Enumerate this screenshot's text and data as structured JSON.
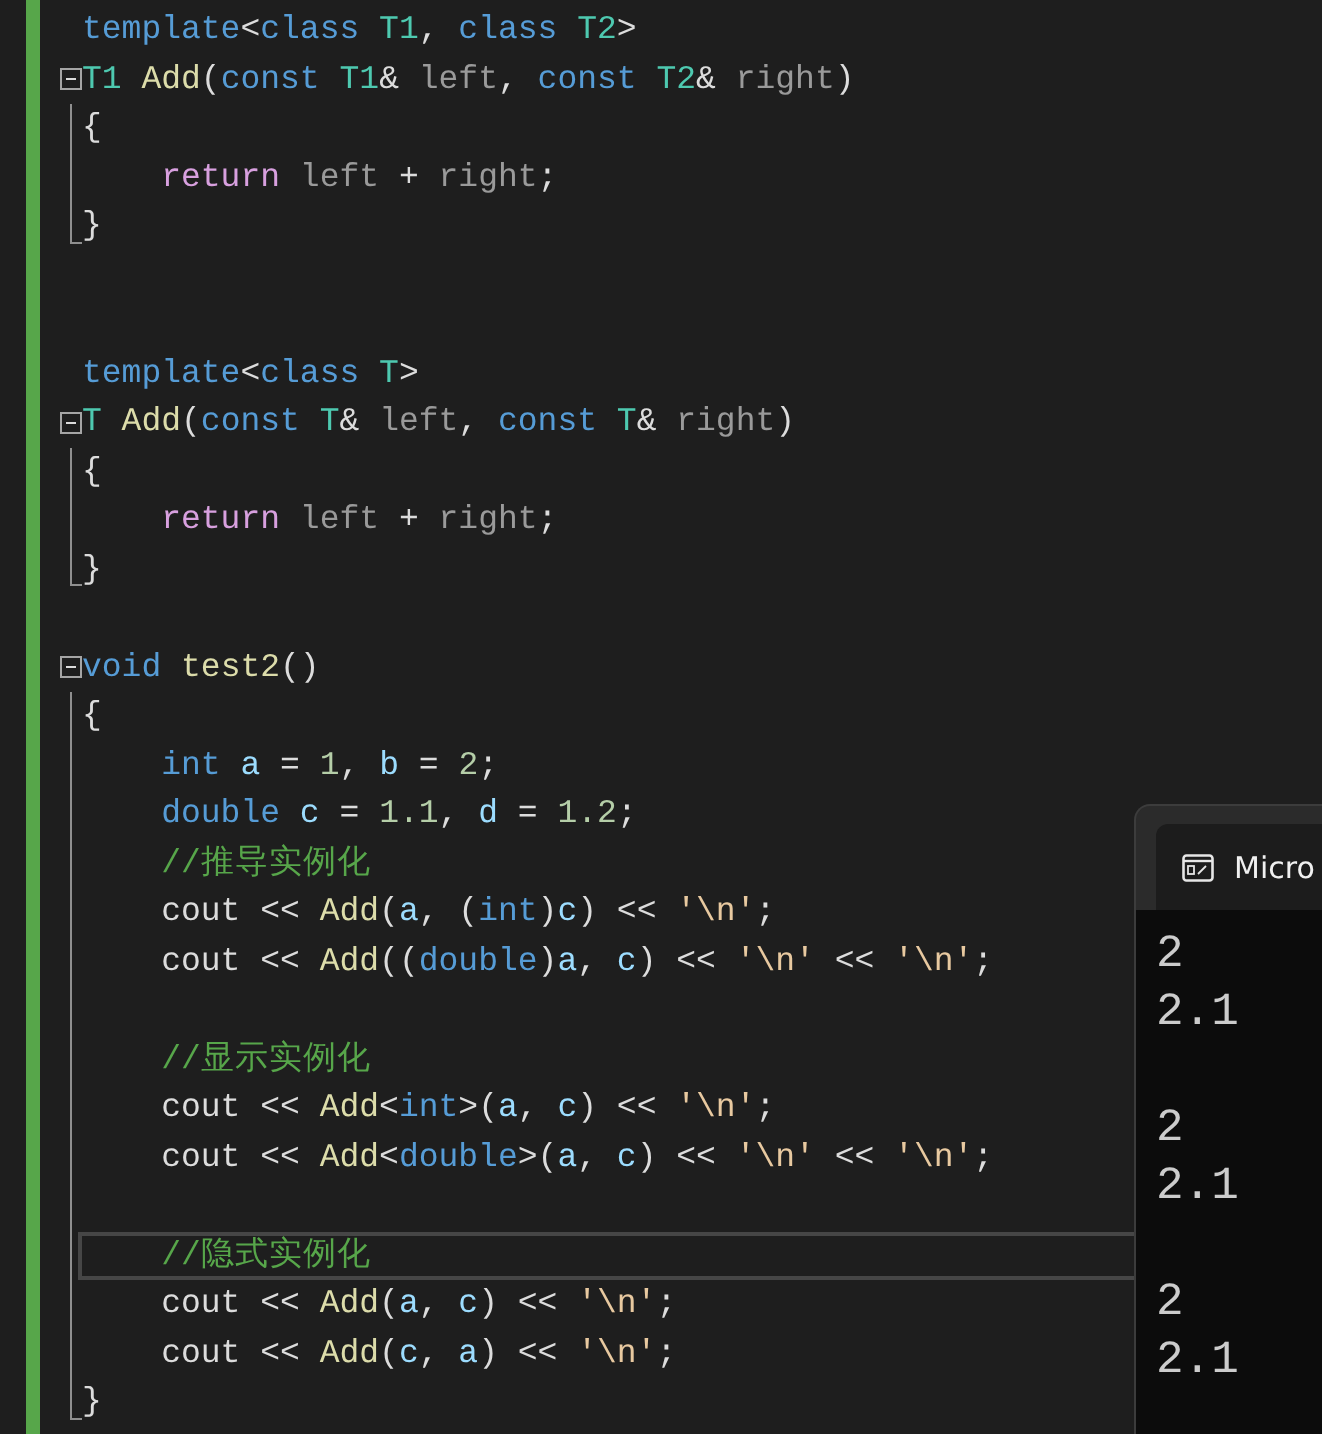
{
  "editor": {
    "lines": [
      {
        "kind": "code",
        "tokens": [
          {
            "kind": "kw",
            "text": "template"
          },
          {
            "kind": "op",
            "text": "<"
          },
          {
            "kind": "kw",
            "text": "class"
          },
          {
            "kind": "type",
            "text": " T1"
          },
          {
            "kind": "op",
            "text": ", "
          },
          {
            "kind": "kw",
            "text": "class"
          },
          {
            "kind": "type",
            "text": " T2"
          },
          {
            "kind": "op",
            "text": ">"
          }
        ]
      },
      {
        "kind": "code",
        "tokens": [
          {
            "kind": "type",
            "text": "T1"
          },
          {
            "kind": "fn",
            "text": " Add"
          },
          {
            "kind": "op",
            "text": "("
          },
          {
            "kind": "kw",
            "text": "const"
          },
          {
            "kind": "type",
            "text": " T1"
          },
          {
            "kind": "op",
            "text": "& "
          },
          {
            "kind": "param",
            "text": "left"
          },
          {
            "kind": "op",
            "text": ", "
          },
          {
            "kind": "kw",
            "text": "const"
          },
          {
            "kind": "type",
            "text": " T2"
          },
          {
            "kind": "op",
            "text": "& "
          },
          {
            "kind": "param",
            "text": "right"
          },
          {
            "kind": "op",
            "text": ")"
          }
        ],
        "expanded": true,
        "children": [
          {
            "kind": "code",
            "tokens": [
              {
                "kind": "op",
                "text": "{"
              }
            ]
          },
          {
            "kind": "code",
            "tokens": [
              {
                "kind": "ctrl",
                "text": "    return"
              },
              {
                "kind": "param",
                "text": " left"
              },
              {
                "kind": "op",
                "text": " + "
              },
              {
                "kind": "param",
                "text": "right"
              },
              {
                "kind": "op",
                "text": ";"
              }
            ]
          },
          {
            "kind": "code",
            "tokens": [
              {
                "kind": "op",
                "text": "}"
              }
            ]
          }
        ]
      },
      {
        "kind": "blank"
      },
      {
        "kind": "blank"
      },
      {
        "kind": "code",
        "tokens": [
          {
            "kind": "kw",
            "text": "template"
          },
          {
            "kind": "op",
            "text": "<"
          },
          {
            "kind": "kw",
            "text": "class"
          },
          {
            "kind": "type",
            "text": " T"
          },
          {
            "kind": "op",
            "text": ">"
          }
        ]
      },
      {
        "kind": "code",
        "tokens": [
          {
            "kind": "type",
            "text": "T"
          },
          {
            "kind": "fn",
            "text": " Add"
          },
          {
            "kind": "op",
            "text": "("
          },
          {
            "kind": "kw",
            "text": "const"
          },
          {
            "kind": "type",
            "text": " T"
          },
          {
            "kind": "op",
            "text": "& "
          },
          {
            "kind": "param",
            "text": "left"
          },
          {
            "kind": "op",
            "text": ", "
          },
          {
            "kind": "kw",
            "text": "const"
          },
          {
            "kind": "type",
            "text": " T"
          },
          {
            "kind": "op",
            "text": "& "
          },
          {
            "kind": "param",
            "text": "right"
          },
          {
            "kind": "op",
            "text": ")"
          }
        ],
        "expanded": true,
        "children": [
          {
            "kind": "code",
            "tokens": [
              {
                "kind": "op",
                "text": "{"
              }
            ]
          },
          {
            "kind": "code",
            "tokens": [
              {
                "kind": "ctrl",
                "text": "    return"
              },
              {
                "kind": "param",
                "text": " left"
              },
              {
                "kind": "op",
                "text": " + "
              },
              {
                "kind": "param",
                "text": "right"
              },
              {
                "kind": "op",
                "text": ";"
              }
            ]
          },
          {
            "kind": "code",
            "tokens": [
              {
                "kind": "op",
                "text": "}"
              }
            ]
          }
        ]
      },
      {
        "kind": "blank"
      },
      {
        "kind": "code",
        "tokens": [
          {
            "kind": "kw",
            "text": "void"
          },
          {
            "kind": "fn",
            "text": " test2"
          },
          {
            "kind": "op",
            "text": "()"
          }
        ],
        "expanded": true,
        "children": [
          {
            "kind": "code",
            "tokens": [
              {
                "kind": "op",
                "text": "{"
              }
            ]
          },
          {
            "kind": "code",
            "tokens": [
              {
                "kind": "kw",
                "text": "    int"
              },
              {
                "kind": "var",
                "text": " a"
              },
              {
                "kind": "op",
                "text": " = "
              },
              {
                "kind": "num",
                "text": "1"
              },
              {
                "kind": "op",
                "text": ", "
              },
              {
                "kind": "var",
                "text": "b"
              },
              {
                "kind": "op",
                "text": " = "
              },
              {
                "kind": "num",
                "text": "2"
              },
              {
                "kind": "op",
                "text": ";"
              }
            ]
          },
          {
            "kind": "code",
            "tokens": [
              {
                "kind": "kw",
                "text": "    double"
              },
              {
                "kind": "var",
                "text": " c"
              },
              {
                "kind": "op",
                "text": " = "
              },
              {
                "kind": "num",
                "text": "1.1"
              },
              {
                "kind": "op",
                "text": ", "
              },
              {
                "kind": "var",
                "text": "d"
              },
              {
                "kind": "op",
                "text": " = "
              },
              {
                "kind": "num",
                "text": "1.2"
              },
              {
                "kind": "op",
                "text": ";"
              }
            ]
          },
          {
            "kind": "code",
            "tokens": [
              {
                "kind": "cmt",
                "text": "    //推导实例化"
              }
            ]
          },
          {
            "kind": "code",
            "tokens": [
              {
                "kind": "op",
                "text": "    cout << "
              },
              {
                "kind": "fn",
                "text": "Add"
              },
              {
                "kind": "op",
                "text": "("
              },
              {
                "kind": "var",
                "text": "a"
              },
              {
                "kind": "op",
                "text": ", ("
              },
              {
                "kind": "kw",
                "text": "int"
              },
              {
                "kind": "op",
                "text": ")"
              },
              {
                "kind": "var",
                "text": "c"
              },
              {
                "kind": "op",
                "text": ") << "
              },
              {
                "kind": "str",
                "text": "'\\n'"
              },
              {
                "kind": "op",
                "text": ";"
              }
            ]
          },
          {
            "kind": "code",
            "tokens": [
              {
                "kind": "op",
                "text": "    cout << "
              },
              {
                "kind": "fn",
                "text": "Add"
              },
              {
                "kind": "op",
                "text": "(("
              },
              {
                "kind": "kw",
                "text": "double"
              },
              {
                "kind": "op",
                "text": ")"
              },
              {
                "kind": "var",
                "text": "a"
              },
              {
                "kind": "op",
                "text": ", "
              },
              {
                "kind": "var",
                "text": "c"
              },
              {
                "kind": "op",
                "text": ") << "
              },
              {
                "kind": "str",
                "text": "'\\n'"
              },
              {
                "kind": "op",
                "text": " << "
              },
              {
                "kind": "str",
                "text": "'\\n'"
              },
              {
                "kind": "op",
                "text": ";"
              }
            ]
          },
          {
            "kind": "blank"
          },
          {
            "kind": "code",
            "tokens": [
              {
                "kind": "cmt",
                "text": "    //显示实例化"
              }
            ]
          },
          {
            "kind": "code",
            "tokens": [
              {
                "kind": "op",
                "text": "    cout << "
              },
              {
                "kind": "fn",
                "text": "Add"
              },
              {
                "kind": "op",
                "text": "<"
              },
              {
                "kind": "kw",
                "text": "int"
              },
              {
                "kind": "op",
                "text": ">("
              },
              {
                "kind": "var",
                "text": "a"
              },
              {
                "kind": "op",
                "text": ", "
              },
              {
                "kind": "var",
                "text": "c"
              },
              {
                "kind": "op",
                "text": ") << "
              },
              {
                "kind": "str",
                "text": "'\\n'"
              },
              {
                "kind": "op",
                "text": ";"
              }
            ]
          },
          {
            "kind": "code",
            "tokens": [
              {
                "kind": "op",
                "text": "    cout << "
              },
              {
                "kind": "fn",
                "text": "Add"
              },
              {
                "kind": "op",
                "text": "<"
              },
              {
                "kind": "kw",
                "text": "double"
              },
              {
                "kind": "op",
                "text": ">("
              },
              {
                "kind": "var",
                "text": "a"
              },
              {
                "kind": "op",
                "text": ", "
              },
              {
                "kind": "var",
                "text": "c"
              },
              {
                "kind": "op",
                "text": ") << "
              },
              {
                "kind": "str",
                "text": "'\\n'"
              },
              {
                "kind": "op",
                "text": " << "
              },
              {
                "kind": "str",
                "text": "'\\n'"
              },
              {
                "kind": "op",
                "text": ";"
              }
            ]
          },
          {
            "kind": "blank"
          },
          {
            "kind": "code",
            "tokens": [
              {
                "kind": "cmt",
                "text": "    //隐式实例化"
              }
            ],
            "current": true
          },
          {
            "kind": "code",
            "tokens": [
              {
                "kind": "op",
                "text": "    cout << "
              },
              {
                "kind": "fn",
                "text": "Add"
              },
              {
                "kind": "op",
                "text": "("
              },
              {
                "kind": "var",
                "text": "a"
              },
              {
                "kind": "op",
                "text": ", "
              },
              {
                "kind": "var",
                "text": "c"
              },
              {
                "kind": "op",
                "text": ") << "
              },
              {
                "kind": "str",
                "text": "'\\n'"
              },
              {
                "kind": "op",
                "text": ";"
              }
            ]
          },
          {
            "kind": "code",
            "tokens": [
              {
                "kind": "op",
                "text": "    cout << "
              },
              {
                "kind": "fn",
                "text": "Add"
              },
              {
                "kind": "op",
                "text": "("
              },
              {
                "kind": "var",
                "text": "c"
              },
              {
                "kind": "op",
                "text": ", "
              },
              {
                "kind": "var",
                "text": "a"
              },
              {
                "kind": "op",
                "text": ") << "
              },
              {
                "kind": "str",
                "text": "'\\n'"
              },
              {
                "kind": "op",
                "text": ";"
              }
            ]
          },
          {
            "kind": "code",
            "tokens": [
              {
                "kind": "op",
                "text": "}"
              }
            ]
          }
        ]
      }
    ]
  },
  "console": {
    "tab_title": "Micro",
    "output_groups": [
      [
        "2",
        "2.1"
      ],
      [
        "2",
        "2.1"
      ],
      [
        "2",
        "2.1"
      ]
    ]
  }
}
